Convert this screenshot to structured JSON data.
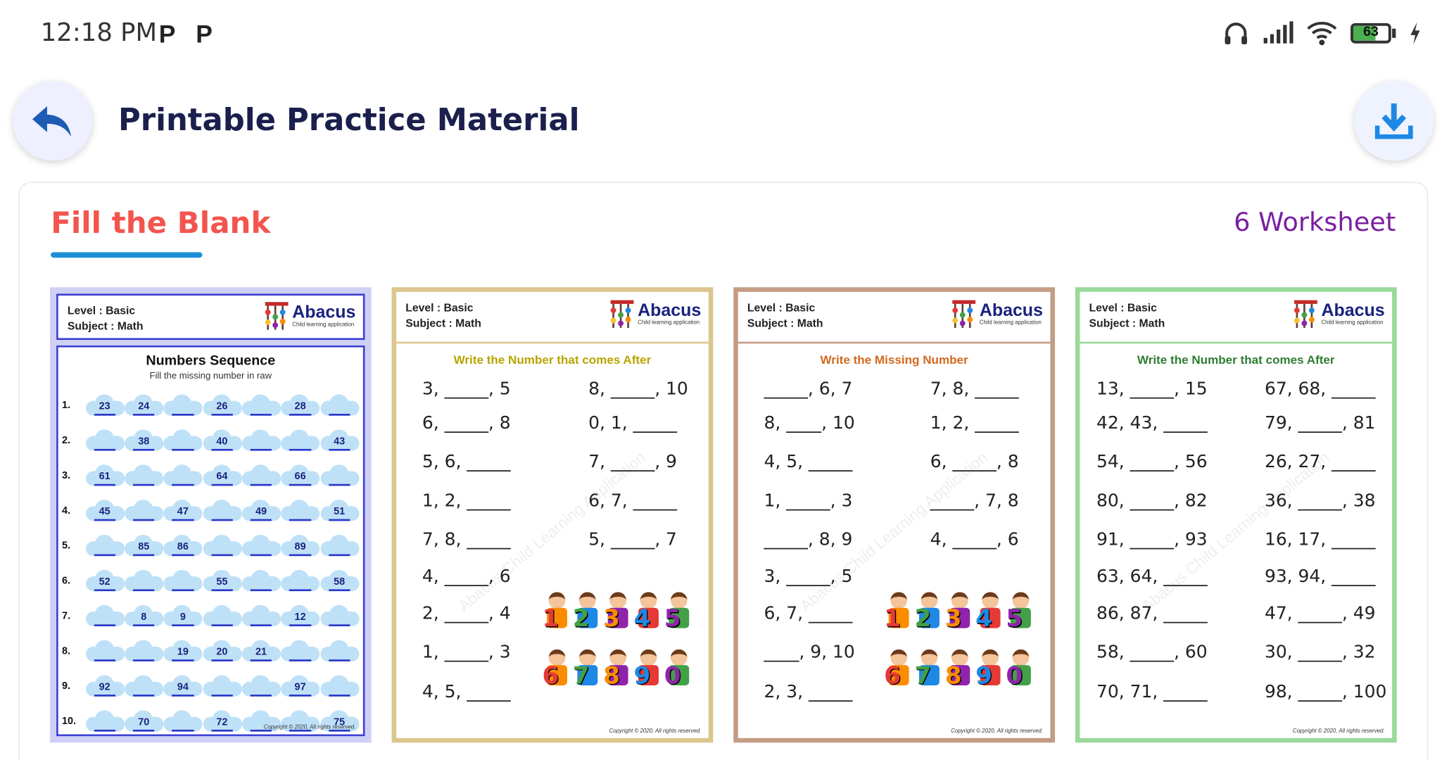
{
  "status": {
    "time": "12:18 PM",
    "notif1": "P",
    "notif2": "P",
    "battery": "63",
    "battery_level": 0.63
  },
  "header": {
    "title": "Printable Practice Material"
  },
  "section": {
    "title": "Fill the Blank",
    "count": "6 Worksheet"
  },
  "colors": {
    "title_red": "#f2554e",
    "count_purple": "#7b1fa2",
    "underline_blue": "#1d8fd6",
    "ws1_border": "#cfd0f5",
    "ws2_border": "#dcc68e",
    "ws3_border": "#c49c84",
    "ws4_border": "#9ad99a"
  },
  "worksheets": [
    {
      "level": "Level : Basic",
      "subject": "Subject : Math",
      "logo_name": "Abacus",
      "logo_sub": "Child learning application",
      "title": "Numbers Sequence",
      "subtitle": "Fill the missing number in raw",
      "rows": [
        {
          "n": "1.",
          "cells": [
            "23",
            "24",
            "",
            "26",
            "",
            "28",
            ""
          ]
        },
        {
          "n": "2.",
          "cells": [
            "",
            "38",
            "",
            "40",
            "",
            "",
            "43"
          ]
        },
        {
          "n": "3.",
          "cells": [
            "61",
            "",
            "",
            "64",
            "",
            "66",
            ""
          ]
        },
        {
          "n": "4.",
          "cells": [
            "45",
            "",
            "47",
            "",
            "49",
            "",
            "51"
          ]
        },
        {
          "n": "5.",
          "cells": [
            "",
            "85",
            "86",
            "",
            "",
            "89",
            ""
          ]
        },
        {
          "n": "6.",
          "cells": [
            "52",
            "",
            "",
            "55",
            "",
            "",
            "58"
          ]
        },
        {
          "n": "7.",
          "cells": [
            "",
            "8",
            "9",
            "",
            "",
            "12",
            ""
          ]
        },
        {
          "n": "8.",
          "cells": [
            "",
            "",
            "19",
            "20",
            "21",
            "",
            ""
          ]
        },
        {
          "n": "9.",
          "cells": [
            "92",
            "",
            "94",
            "",
            "",
            "97",
            ""
          ]
        },
        {
          "n": "10.",
          "cells": [
            "",
            "70",
            "",
            "72",
            "",
            "",
            "75"
          ]
        }
      ],
      "copyright": "Copyright © 2020, All rights reserved."
    },
    {
      "level": "Level : Basic",
      "subject": "Subject : Math",
      "logo_name": "Abacus",
      "logo_sub": "Child learning application",
      "title": "Write the Number that comes After",
      "left": [
        "3, _____, 5",
        "6, _____, 8",
        "5, 6, _____",
        "1, 2, _____",
        "7, 8, _____",
        "4, _____, 6",
        "2, _____, 4",
        "1, _____, 3",
        "4, 5, _____"
      ],
      "right": [
        "8, _____, 10",
        "0, 1, _____",
        "7, _____, 9",
        "6, 7, _____",
        "5, _____, 7"
      ],
      "copyright": "Copyright © 2020, All rights reserved."
    },
    {
      "level": "Level : Basic",
      "subject": "Subject : Math",
      "logo_name": "Abacus",
      "logo_sub": "Child learning application",
      "title": "Write the Missing Number",
      "left": [
        "_____, 6, 7",
        "8, ____, 10",
        "4, 5, _____",
        "1, _____, 3",
        "_____, 8, 9",
        "3, _____, 5",
        "6, 7, _____",
        "____, 9, 10",
        "2, 3, _____"
      ],
      "right": [
        "7, 8, _____",
        "1, 2, _____",
        "6, _____, 8",
        "_____, 7, 8",
        "4, _____, 6"
      ],
      "copyright": "Copyright © 2020, All rights reserved."
    },
    {
      "level": "Level : Basic",
      "subject": "Subject : Math",
      "logo_name": "Abacus",
      "logo_sub": "Child learning application",
      "title": "Write the Number that comes After",
      "left": [
        "13, _____, 15",
        "42, 43, _____",
        "54, _____, 56",
        "80, _____, 82",
        "91, _____, 93",
        "63, 64, _____",
        "86, 87, _____",
        "58, _____, 60",
        "70, 71, _____"
      ],
      "right": [
        "67, 68, _____",
        "79, _____, 81",
        "26, 27, _____",
        "36, _____, 38",
        "16, 17, _____",
        "93, 94, _____",
        "47, _____, 49",
        "30, _____, 32",
        "98, _____, 100"
      ],
      "copyright": "Copyright © 2020, All rights reserved."
    }
  ]
}
